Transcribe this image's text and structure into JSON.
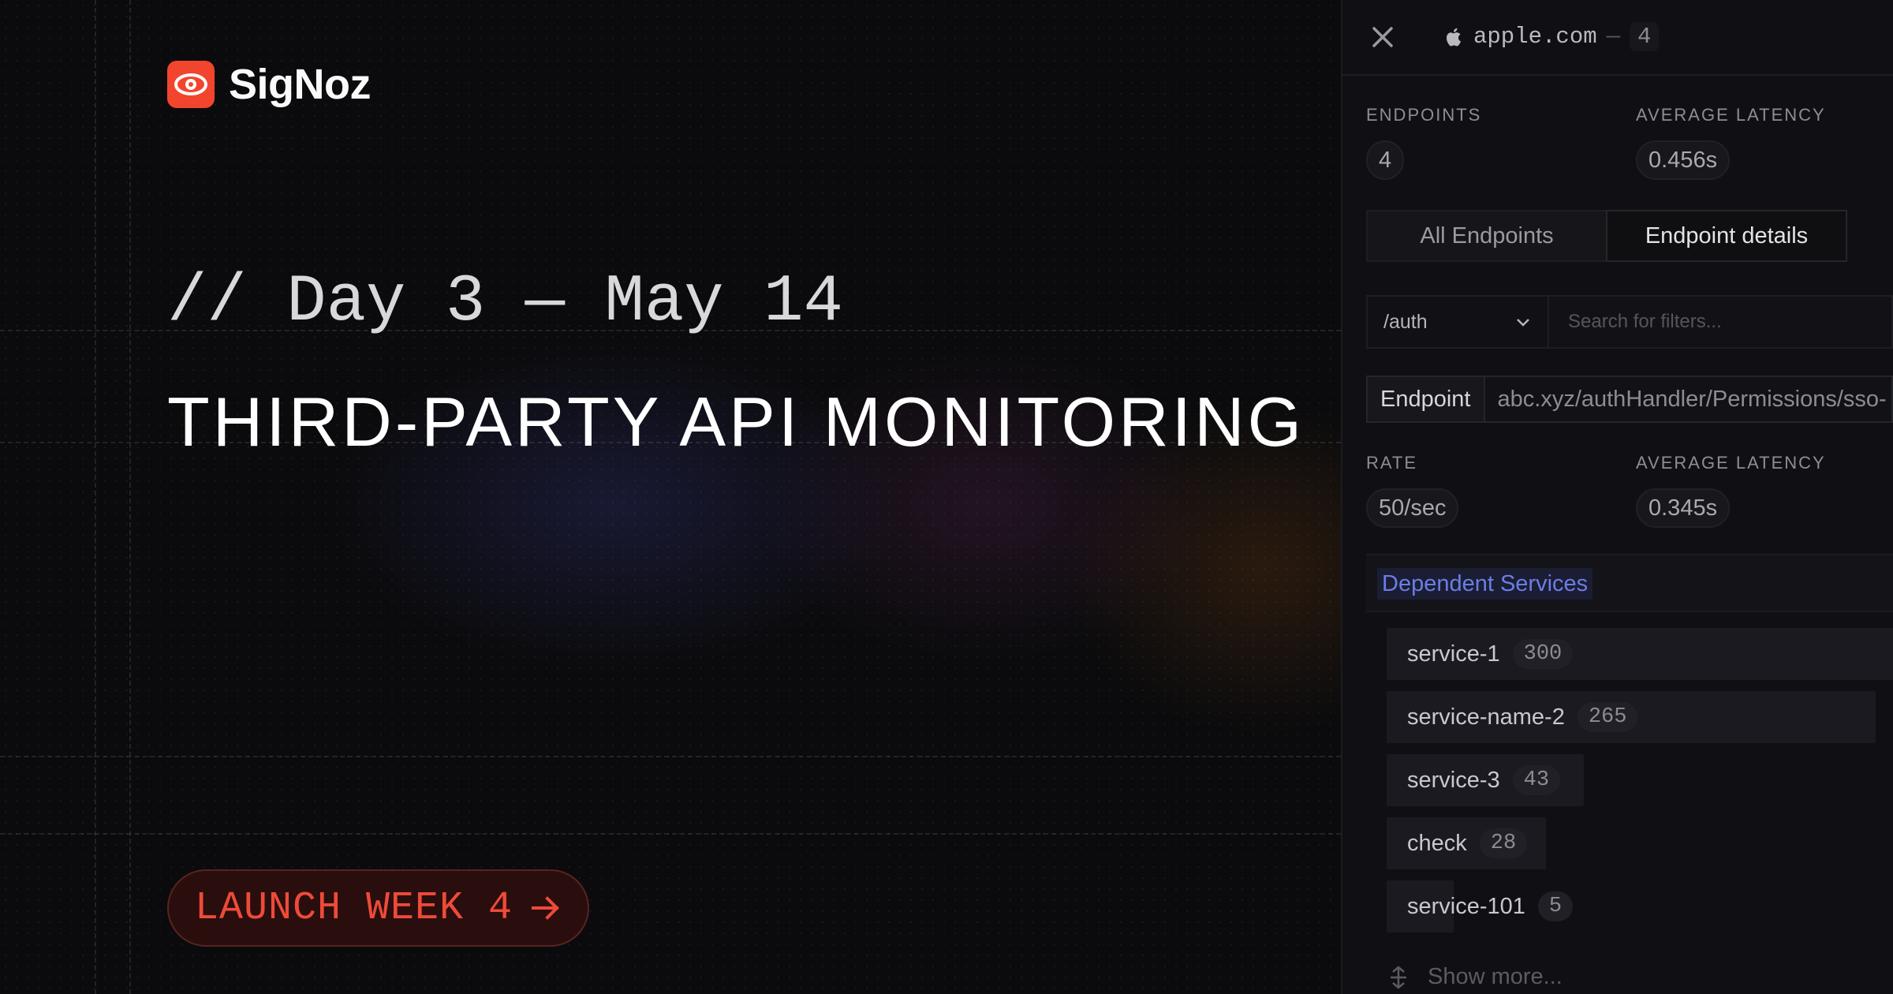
{
  "brand": {
    "name": "SigNoz",
    "accent": "#f2452d"
  },
  "hero": {
    "day_line": "// Day 3 — May 14",
    "headline": "THIRD-PARTY API MONITORING"
  },
  "cta": {
    "label": "LAUNCH WEEK 4",
    "color": "#ee4a3a",
    "icon": "arrow-right-icon"
  },
  "panel": {
    "header": {
      "domain": "apple.com",
      "separator": "—",
      "count": "4",
      "icon": "apple-icon"
    },
    "summary": {
      "endpoints_label": "ENDPOINTS",
      "endpoints_value": "4",
      "latency_label": "AVERAGE LATENCY",
      "latency_value": "0.456s"
    },
    "tabs": [
      {
        "label": "All Endpoints",
        "active": false
      },
      {
        "label": "Endpoint details",
        "active": true
      }
    ],
    "filter": {
      "selected": "/auth",
      "placeholder": "Search for filters..."
    },
    "endpoint": {
      "label": "Endpoint",
      "value": "abc.xyz/authHandler/Permissions/sso-"
    },
    "detail": {
      "rate_label": "RATE",
      "rate_value": "50/sec",
      "latency_label": "AVERAGE LATENCY",
      "latency_value": "0.345s"
    },
    "dependent": {
      "title": "Dependent Services",
      "title_color": "#6a7ee6",
      "services": [
        {
          "name": "service-1",
          "count": "300"
        },
        {
          "name": "service-name-2",
          "count": "265"
        },
        {
          "name": "service-3",
          "count": "43"
        },
        {
          "name": "check",
          "count": "28"
        },
        {
          "name": "service-101",
          "count": "5"
        }
      ],
      "show_more": "Show more..."
    }
  }
}
